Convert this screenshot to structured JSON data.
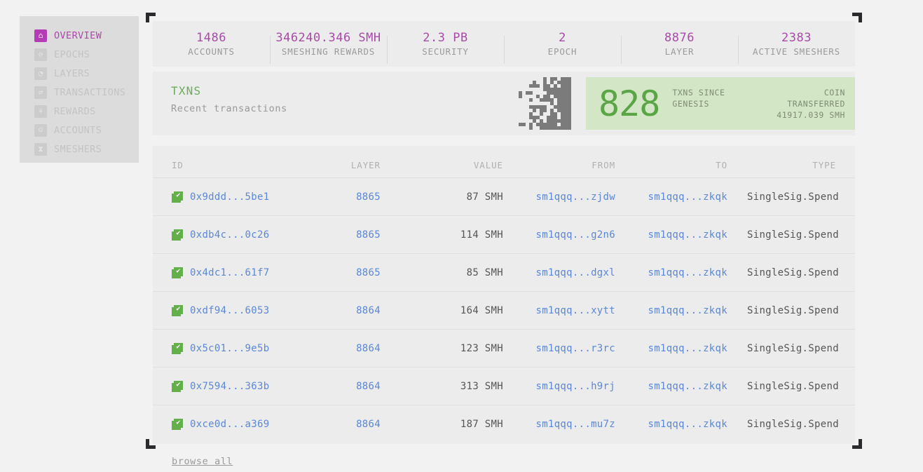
{
  "sidebar": {
    "items": [
      {
        "label": "OVERVIEW",
        "icon": "home-icon",
        "glyph": "⌂",
        "active": true
      },
      {
        "label": "EPOCHS",
        "icon": "epoch-icon",
        "glyph": "⊖",
        "active": false
      },
      {
        "label": "LAYERS",
        "icon": "layers-icon",
        "glyph": "◔",
        "active": false
      },
      {
        "label": "TRANSACTIONS",
        "icon": "transactions-icon",
        "glyph": "⇄",
        "active": false
      },
      {
        "label": "REWARDS",
        "icon": "rewards-icon",
        "glyph": "⚘",
        "active": false
      },
      {
        "label": "ACCOUNTS",
        "icon": "accounts-icon",
        "glyph": "☺",
        "active": false
      },
      {
        "label": "SMESHERS",
        "icon": "smeshers-icon",
        "glyph": "⧗",
        "active": false
      }
    ]
  },
  "stats": [
    {
      "value": "1486",
      "label": "ACCOUNTS"
    },
    {
      "value": "346240.346 SMH",
      "label": "SMESHING REWARDS"
    },
    {
      "value": "2.3 PB",
      "label": "SECURITY"
    },
    {
      "value": "2",
      "label": "EPOCH"
    },
    {
      "value": "8876",
      "label": "LAYER"
    },
    {
      "value": "2383",
      "label": "ACTIVE SMESHERS"
    }
  ],
  "txns_header": {
    "title": "TXNS",
    "subtitle": "Recent transactions",
    "count": "828",
    "count_label_line1": "TXNS SINCE",
    "count_label_line2": "GENESIS",
    "transferred_label": "COIN TRANSFERRED",
    "transferred_value": "41917.039 SMH"
  },
  "table": {
    "columns": [
      "ID",
      "LAYER",
      "VALUE",
      "FROM",
      "TO",
      "TYPE"
    ],
    "rows": [
      {
        "id": "0x9ddd...5be1",
        "layer": "8865",
        "value": "87 SMH",
        "from": "sm1qqq...zjdw",
        "to": "sm1qqq...zkqk",
        "type": "SingleSig.Spend"
      },
      {
        "id": "0xdb4c...0c26",
        "layer": "8865",
        "value": "114 SMH",
        "from": "sm1qqq...g2n6",
        "to": "sm1qqq...zkqk",
        "type": "SingleSig.Spend"
      },
      {
        "id": "0x4dc1...61f7",
        "layer": "8865",
        "value": "85 SMH",
        "from": "sm1qqq...dgxl",
        "to": "sm1qqq...zkqk",
        "type": "SingleSig.Spend"
      },
      {
        "id": "0xdf94...6053",
        "layer": "8864",
        "value": "164 SMH",
        "from": "sm1qqq...xytt",
        "to": "sm1qqq...zkqk",
        "type": "SingleSig.Spend"
      },
      {
        "id": "0x5c01...9e5b",
        "layer": "8864",
        "value": "123 SMH",
        "from": "sm1qqq...r3rc",
        "to": "sm1qqq...zkqk",
        "type": "SingleSig.Spend"
      },
      {
        "id": "0x7594...363b",
        "layer": "8864",
        "value": "313 SMH",
        "from": "sm1qqq...h9rj",
        "to": "sm1qqq...zkqk",
        "type": "SingleSig.Spend"
      },
      {
        "id": "0xce0d...a369",
        "layer": "8864",
        "value": "187 SMH",
        "from": "sm1qqq...mu7z",
        "to": "sm1qqq...zkqk",
        "type": "SingleSig.Spend"
      }
    ],
    "status_icon": "checkbox-checked-icon",
    "check_glyph": "✔"
  },
  "footer": {
    "browse_all": "browse all"
  },
  "colors": {
    "accent_purple": "#a84ba8",
    "accent_green": "#5aa545",
    "link_blue": "#5b87d6",
    "card_green_bg": "#d3e6c6",
    "panel_bg": "#ececec",
    "page_bg": "#f2f2f2"
  }
}
